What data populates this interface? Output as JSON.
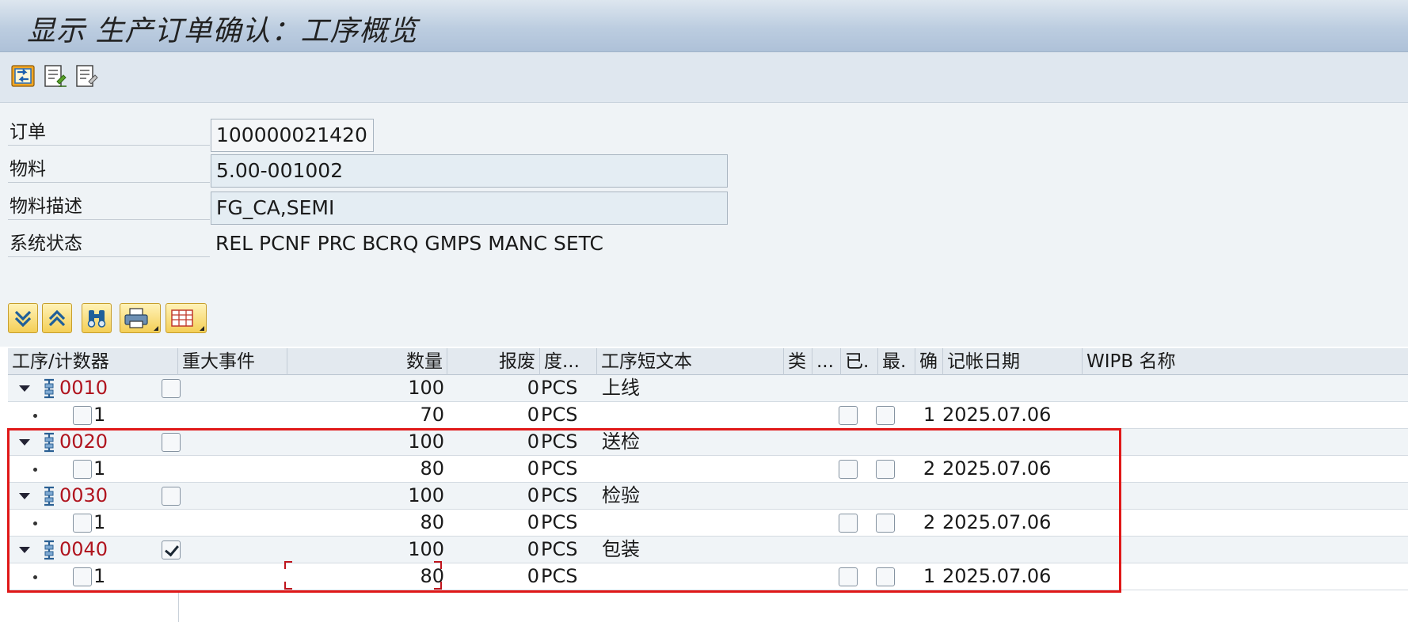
{
  "window": {
    "title": "显示 生产订单确认：工序概览"
  },
  "app_toolbar": {
    "buttons": [
      {
        "name": "navigate-icon"
      },
      {
        "name": "edit-detail-icon"
      },
      {
        "name": "display-detail-icon"
      }
    ]
  },
  "header": {
    "order_label": "订单",
    "order_value": "100000021420",
    "material_label": "物料",
    "material_value": "5.00-001002",
    "material_desc_label": "物料描述",
    "material_desc_value": "FG_CA,SEMI",
    "system_status_label": "系统状态",
    "system_status_value": "REL  PCNF PRC  BCRQ GMPS MANC SETC"
  },
  "alv_toolbar": {
    "buttons": [
      {
        "name": "expand-all-icon"
      },
      {
        "name": "collapse-all-icon"
      },
      {
        "name": "find-icon"
      },
      {
        "name": "print-icon",
        "dropdown": true
      },
      {
        "name": "layout-icon",
        "dropdown": true
      }
    ]
  },
  "grid": {
    "columns": [
      "工序/计数器",
      "重大事件",
      "数量",
      "报废",
      "度...",
      "工序短文本",
      "类",
      "...",
      "已.",
      "最.",
      "确",
      "记帐日期",
      "WIPB 名称"
    ],
    "rows": [
      {
        "type": "operation",
        "op": "0010",
        "milestone": false,
        "qty": "100",
        "scrap": "0",
        "unit": "PCS",
        "text": "上线"
      },
      {
        "type": "confirmation",
        "counter": "1",
        "qty": "70",
        "scrap": "0",
        "unit": "PCS",
        "conf": "1",
        "date": "2025.07.06"
      },
      {
        "type": "operation",
        "op": "0020",
        "milestone": false,
        "qty": "100",
        "scrap": "0",
        "unit": "PCS",
        "text": "送检"
      },
      {
        "type": "confirmation",
        "counter": "1",
        "qty": "80",
        "scrap": "0",
        "unit": "PCS",
        "conf": "2",
        "date": "2025.07.06"
      },
      {
        "type": "operation",
        "op": "0030",
        "milestone": false,
        "qty": "100",
        "scrap": "0",
        "unit": "PCS",
        "text": "检验"
      },
      {
        "type": "confirmation",
        "counter": "1",
        "qty": "80",
        "scrap": "0",
        "unit": "PCS",
        "conf": "2",
        "date": "2025.07.06"
      },
      {
        "type": "operation",
        "op": "0040",
        "milestone": true,
        "qty": "100",
        "scrap": "0",
        "unit": "PCS",
        "text": "包装"
      },
      {
        "type": "confirmation",
        "counter": "1",
        "qty": "80",
        "scrap": "0",
        "unit": "PCS",
        "conf": "1",
        "date": "2025.07.06"
      }
    ]
  },
  "colors": {
    "operation_number": "#b0141e",
    "highlight_box": "#e01818"
  }
}
